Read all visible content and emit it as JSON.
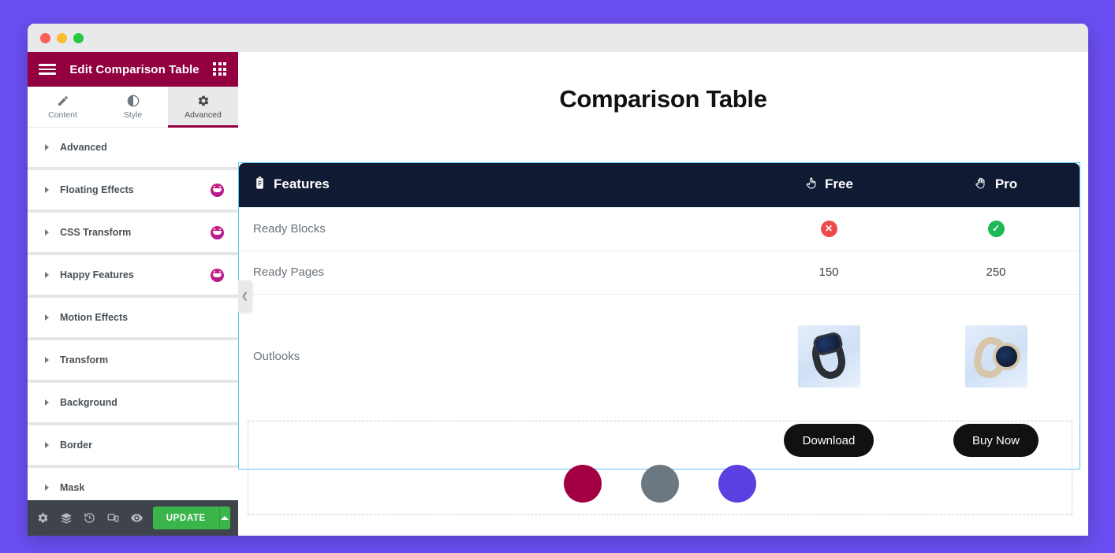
{
  "window": {
    "traffic_lights": [
      "close",
      "minimize",
      "maximize"
    ]
  },
  "panel": {
    "header": {
      "menu_icon": "hamburger-menu-icon",
      "title": "Edit Comparison Table",
      "grid_icon": "widgets-grid-icon"
    },
    "tabs": [
      {
        "label": "Content",
        "icon": "pencil-icon",
        "active": false
      },
      {
        "label": "Style",
        "icon": "contrast-icon",
        "active": false
      },
      {
        "label": "Advanced",
        "icon": "gear-icon",
        "active": true
      }
    ],
    "accordion": [
      {
        "label": "Advanced",
        "pro": false
      },
      {
        "label": "Floating Effects",
        "pro": true
      },
      {
        "label": "CSS Transform",
        "pro": true
      },
      {
        "label": "Happy Features",
        "pro": true
      },
      {
        "label": "Motion Effects",
        "pro": false
      },
      {
        "label": "Transform",
        "pro": false
      },
      {
        "label": "Background",
        "pro": false
      },
      {
        "label": "Border",
        "pro": false
      },
      {
        "label": "Mask",
        "pro": false
      }
    ],
    "footer": {
      "icons": [
        "settings-gear-icon",
        "navigator-layers-icon",
        "history-icon",
        "responsive-mode-icon",
        "preview-eye-icon"
      ],
      "update_label": "UPDATE",
      "caret_icon": "caret-up-icon"
    },
    "collapse_handle_icon": "chevron-left-icon",
    "accent_color": "#93003f",
    "update_color": "#39b54a"
  },
  "canvas": {
    "page_title": "Comparison Table",
    "table": {
      "header_bg": "#101a33",
      "selection_border": "#5bc8f0",
      "columns": [
        {
          "label": "Features",
          "icon": "clipboard-list-icon"
        },
        {
          "label": "Free",
          "icon": "pointing-up-hand-icon"
        },
        {
          "label": "Pro",
          "icon": "raised-hand-icon"
        }
      ],
      "rows": [
        {
          "feature": "Ready Blocks",
          "type": "mark",
          "free": {
            "mark": "no",
            "glyph": "✕",
            "color": "#ef4a4a"
          },
          "pro": {
            "mark": "yes",
            "glyph": "✓",
            "color": "#1db954"
          }
        },
        {
          "feature": "Ready Pages",
          "type": "text",
          "free": "150",
          "pro": "250"
        },
        {
          "feature": "Outlooks",
          "type": "image",
          "free": {
            "alt": "black-smartwatch-image"
          },
          "pro": {
            "alt": "gold-smartwatch-image"
          }
        }
      ],
      "cta": {
        "free": "Download",
        "pro": "Buy Now"
      }
    },
    "empty_section": {
      "circles": [
        {
          "name": "social-circle-1",
          "color": "#a30044"
        },
        {
          "name": "social-circle-2",
          "color": "#6b7882"
        },
        {
          "name": "social-circle-3",
          "color": "#5b3fe0"
        }
      ]
    }
  }
}
